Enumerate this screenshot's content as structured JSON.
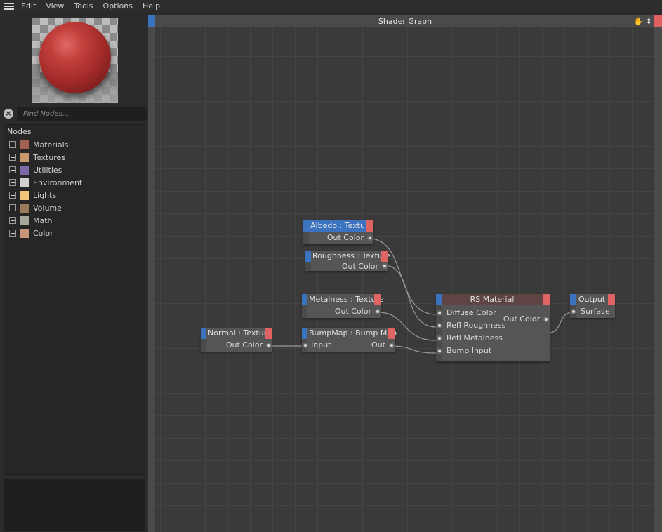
{
  "menu": {
    "items": [
      "Edit",
      "View",
      "Tools",
      "Options",
      "Help"
    ]
  },
  "left_panel": {
    "search_placeholder": "Find Nodes...",
    "nodes_header": "Nodes",
    "categories": [
      {
        "label": "Materials",
        "color": "#a0624e"
      },
      {
        "label": "Textures",
        "color": "#c89a6e"
      },
      {
        "label": "Utilities",
        "color": "#7c6aa8"
      },
      {
        "label": "Environment",
        "color": "#d0d0d0"
      },
      {
        "label": "Lights",
        "color": "#f0c878"
      },
      {
        "label": "Volume",
        "color": "#9a7a5a"
      },
      {
        "label": "Math",
        "color": "#a3a89a"
      },
      {
        "label": "Color",
        "color": "#c8947a"
      }
    ]
  },
  "graph": {
    "title": "Shader Graph",
    "nodes": {
      "albedo": {
        "title": "Albedo : Texture",
        "ports": [
          "Out Color"
        ]
      },
      "roughness": {
        "title": "Roughness : Texture",
        "ports": [
          "Out Color"
        ]
      },
      "metalness": {
        "title": "Metalness : Texture",
        "ports": [
          "Out Color"
        ]
      },
      "normal": {
        "title": "Normal : Texture",
        "ports": [
          "Out Color"
        ]
      },
      "bumpmap": {
        "title": "BumpMap : Bump Map",
        "input": "Input",
        "output": "Out"
      },
      "rs_material": {
        "title": "RS Material",
        "inputs": [
          "Diffuse Color",
          "Refl Roughness",
          "Refl Metalness",
          "Bump Input"
        ],
        "output": "Out Color"
      },
      "output": {
        "title": "Output",
        "input": "Surface"
      }
    }
  }
}
